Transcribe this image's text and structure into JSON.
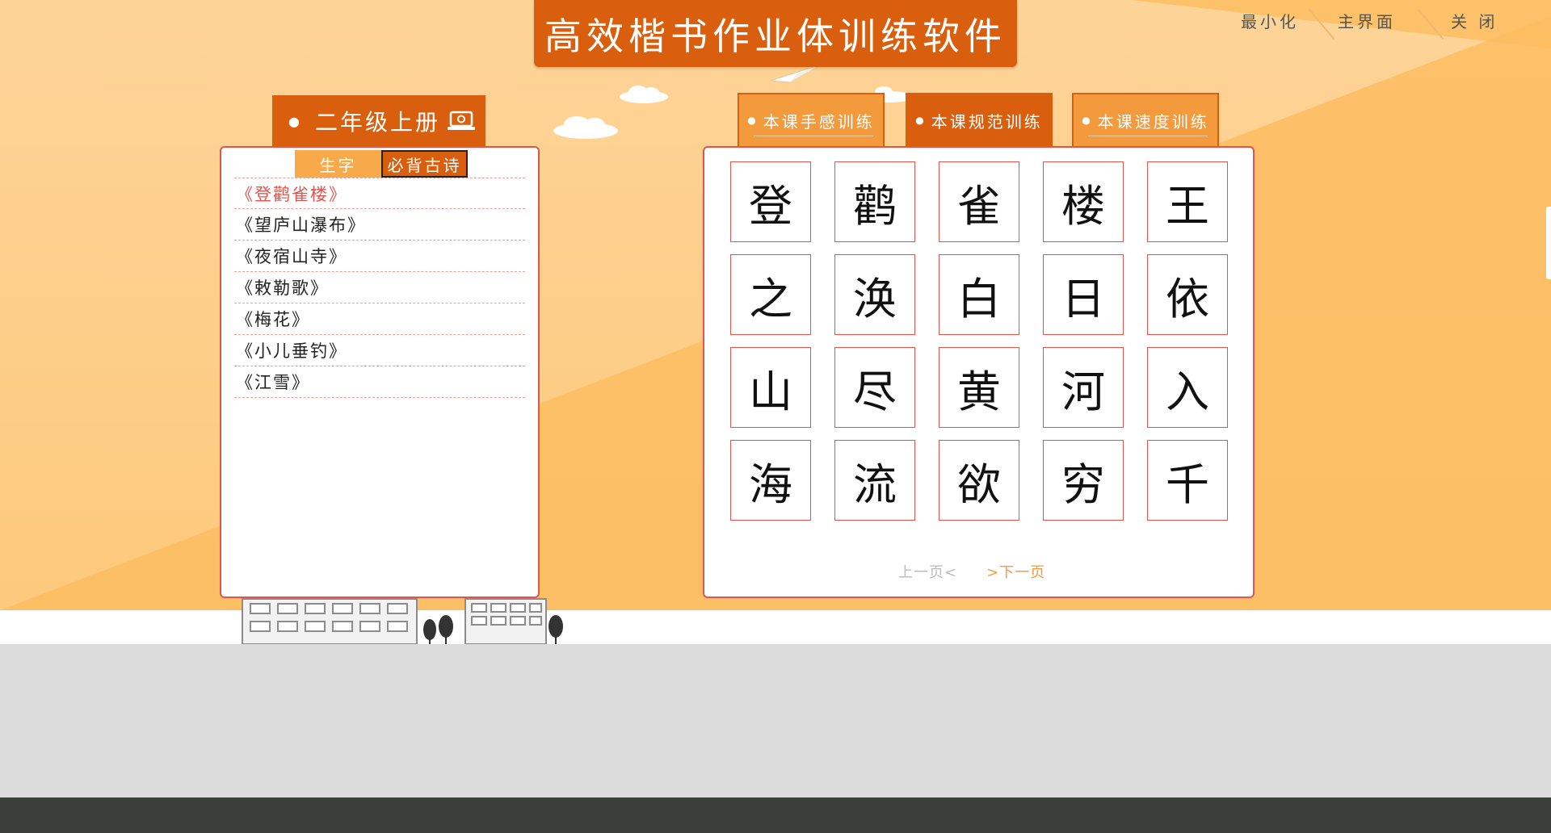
{
  "app": {
    "title": "高效楷书作业体训练软件"
  },
  "window_controls": {
    "minimize": "最小化",
    "main": "主界面",
    "close": "关 闭"
  },
  "left": {
    "grade": "二年级上册",
    "tabs": [
      "生字",
      "必背古诗"
    ],
    "active_tab": "必背古诗",
    "poems": [
      "《登鹳雀楼》",
      "《望庐山瀑布》",
      "《夜宿山寺》",
      "《敕勒歌》",
      "《梅花》",
      "《小儿垂钓》",
      "《江雪》"
    ],
    "selected_poem": "《登鹳雀楼》"
  },
  "right": {
    "tabs": [
      "本课手感训练",
      "本课规范训练",
      "本课速度训练"
    ],
    "active_tab": "本课规范训练",
    "characters": [
      "登",
      "鹳",
      "雀",
      "楼",
      "王",
      "之",
      "涣",
      "白",
      "日",
      "依",
      "山",
      "尽",
      "黄",
      "河",
      "入",
      "海",
      "流",
      "欲",
      "穷",
      "千"
    ],
    "prev_page": "上一页<",
    "next_page": ">下一页"
  },
  "colors": {
    "brand_orange": "#d95f0e",
    "light_orange": "#f39a3c",
    "panel_border": "#e2544c",
    "background": "#fdc97c"
  }
}
